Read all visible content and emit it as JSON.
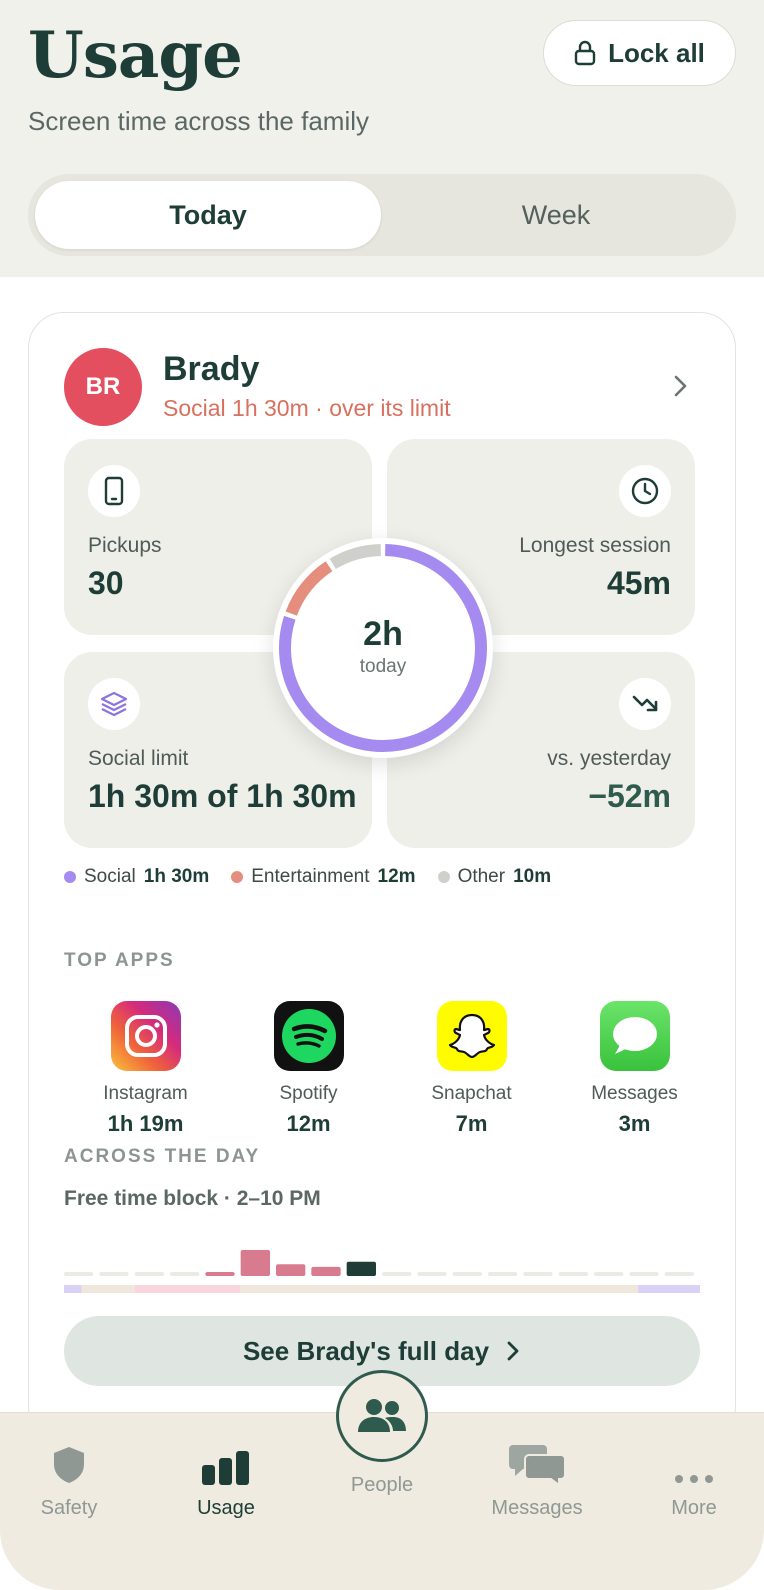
{
  "header": {
    "title": "Usage",
    "subtitle": "Screen time across the family",
    "lock_label": "Lock all",
    "tabs": [
      {
        "label": "Today",
        "active": true
      },
      {
        "label": "Week",
        "active": false
      }
    ]
  },
  "child": {
    "initials": "BR",
    "name": "Brady",
    "status": "Social 1h 30m · over its limit",
    "avatar_color": "#e34f5e"
  },
  "stats": {
    "pickups": {
      "label": "Pickups",
      "value": "30"
    },
    "longest_session": {
      "label": "Longest session",
      "value": "45m"
    },
    "social_limit": {
      "label": "Social limit",
      "value": "1h 30m of 1h 30m"
    },
    "vs_yesterday": {
      "label": "vs. yesterday",
      "value": "−52m"
    }
  },
  "donut": {
    "total": "2h",
    "caption": "today",
    "segments": [
      {
        "name": "Social",
        "minutes": 90,
        "color": "#a58bef"
      },
      {
        "name": "Entertainment",
        "minutes": 12,
        "color": "#e58e7e"
      },
      {
        "name": "Other",
        "minutes": 10,
        "color": "#cfd0cb"
      }
    ]
  },
  "legend": [
    {
      "name": "Social",
      "value": "1h 30m",
      "color": "#a58bef"
    },
    {
      "name": "Entertainment",
      "value": "12m",
      "color": "#e58e7e"
    },
    {
      "name": "Other",
      "value": "10m",
      "color": "#cfd0cb"
    }
  ],
  "top_apps": {
    "heading": "TOP APPS",
    "apps": [
      {
        "name": "Instagram",
        "time": "1h 19m",
        "icon": "instagram-icon"
      },
      {
        "name": "Spotify",
        "time": "12m",
        "icon": "spotify-icon"
      },
      {
        "name": "Snapchat",
        "time": "7m",
        "icon": "snapchat-icon"
      },
      {
        "name": "Messages",
        "time": "3m",
        "icon": "messages-icon"
      }
    ]
  },
  "day": {
    "heading": "ACROSS THE DAY",
    "block": "Free time block · 2–10 PM",
    "hour_levels": [
      0,
      0,
      0,
      0,
      0.15,
      1.0,
      0.45,
      0.35,
      0.55,
      0,
      0,
      0,
      0,
      0,
      0,
      0,
      0,
      0
    ],
    "hour_colors": [
      "",
      "",
      "",
      "",
      "#d97b8f",
      "#d97b8f",
      "#d97b8f",
      "#d97b8f",
      "#1d3d36",
      "",
      "",
      "",
      "",
      "",
      "",
      "",
      "",
      ""
    ],
    "band": [
      {
        "from": 0,
        "to": 1,
        "color": "#d9d2f5"
      },
      {
        "from": 1,
        "to": 4,
        "color": "#efe6dc"
      },
      {
        "from": 4,
        "to": 10,
        "color": "#f7d6de"
      },
      {
        "from": 10,
        "to": 32.5,
        "color": "#efe6dc"
      },
      {
        "from": 32.5,
        "to": 36,
        "color": "#d9d2f5"
      }
    ]
  },
  "cta": {
    "label": "See Brady's full day"
  },
  "nav": {
    "items": [
      {
        "label": "Safety",
        "icon": "shield-icon"
      },
      {
        "label": "Usage",
        "icon": "bar-chart-icon",
        "active": true
      },
      {
        "label": "People",
        "icon": "people-icon"
      },
      {
        "label": "Messages",
        "icon": "chat-bubbles-icon"
      },
      {
        "label": "More",
        "icon": "more-icon"
      }
    ]
  }
}
